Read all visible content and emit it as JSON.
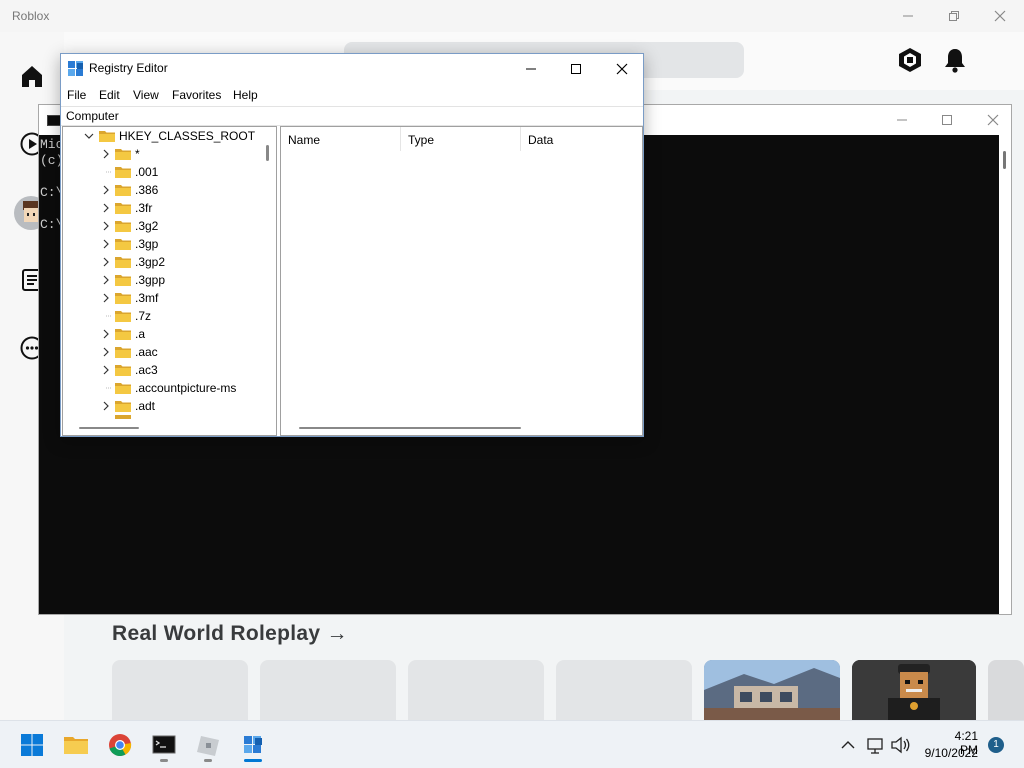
{
  "roblox": {
    "title": "Roblox",
    "section_title": "Real World Roleplay →"
  },
  "cmd": {
    "lines": [
      "Mic",
      "(c)",
      "C:\\",
      "C:\\"
    ]
  },
  "regedit": {
    "title": "Registry Editor",
    "menu": [
      "File",
      "Edit",
      "View",
      "Favorites",
      "Help"
    ],
    "address": "Computer",
    "root_key": "HKEY_CLASSES_ROOT",
    "keys": [
      {
        "label": "*",
        "expandable": true
      },
      {
        "label": ".001",
        "expandable": false
      },
      {
        "label": ".386",
        "expandable": true
      },
      {
        "label": ".3fr",
        "expandable": true
      },
      {
        "label": ".3g2",
        "expandable": true
      },
      {
        "label": ".3gp",
        "expandable": true
      },
      {
        "label": ".3gp2",
        "expandable": true
      },
      {
        "label": ".3gpp",
        "expandable": true
      },
      {
        "label": ".3mf",
        "expandable": true
      },
      {
        "label": ".7z",
        "expandable": false
      },
      {
        "label": ".a",
        "expandable": true
      },
      {
        "label": ".aac",
        "expandable": true
      },
      {
        "label": ".ac3",
        "expandable": true
      },
      {
        "label": ".accountpicture-ms",
        "expandable": false
      },
      {
        "label": ".adt",
        "expandable": true
      }
    ],
    "columns": [
      "Name",
      "Type",
      "Data"
    ]
  },
  "taskbar": {
    "time": "4:21 PM",
    "date": "9/10/2022",
    "notification_count": "1",
    "folder_color": "#f4c842",
    "accent_color": "#0078d4"
  }
}
